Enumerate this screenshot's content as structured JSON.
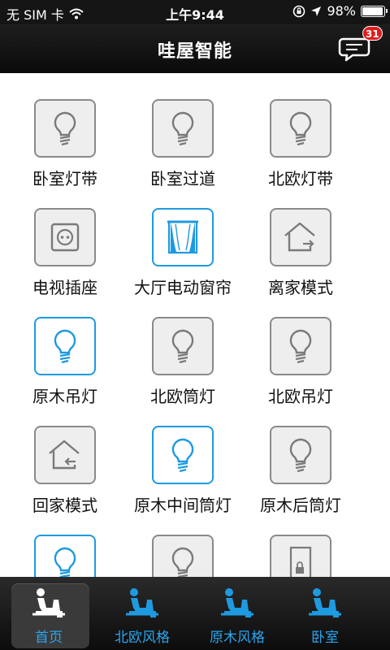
{
  "status_bar": {
    "carrier": "无 SIM 卡",
    "time": "上午9:44",
    "battery": "98%",
    "battery_level": 0.98
  },
  "header": {
    "title": "哇屋智能",
    "message_count": "31"
  },
  "devices": [
    {
      "label": "卧室灯带",
      "icon": "bulb-icon",
      "active": false
    },
    {
      "label": "卧室过道",
      "icon": "bulb-icon",
      "active": false
    },
    {
      "label": "北欧灯带",
      "icon": "bulb-icon",
      "active": false
    },
    {
      "label": "电视插座",
      "icon": "socket-icon",
      "active": false
    },
    {
      "label": "大厅电动窗帘",
      "icon": "curtain-icon",
      "active": true
    },
    {
      "label": "离家模式",
      "icon": "leave-home-icon",
      "active": false
    },
    {
      "label": "原木吊灯",
      "icon": "bulb-icon",
      "active": true
    },
    {
      "label": "北欧筒灯",
      "icon": "bulb-icon",
      "active": false
    },
    {
      "label": "北欧吊灯",
      "icon": "bulb-icon",
      "active": false
    },
    {
      "label": "回家模式",
      "icon": "return-home-icon",
      "active": false
    },
    {
      "label": "原木中间筒灯",
      "icon": "bulb-icon",
      "active": true
    },
    {
      "label": "原木后筒灯",
      "icon": "bulb-icon",
      "active": false
    },
    {
      "label": "",
      "icon": "bulb-icon",
      "active": true
    },
    {
      "label": "",
      "icon": "bulb-icon",
      "active": false
    },
    {
      "label": "",
      "icon": "door-lock-icon",
      "active": false
    }
  ],
  "tabs": [
    {
      "label": "首页",
      "active": true
    },
    {
      "label": "北欧风格",
      "active": false
    },
    {
      "label": "原木风格",
      "active": false
    },
    {
      "label": "卧室",
      "active": false
    }
  ],
  "colors": {
    "accent": "#1e9ae0",
    "inactive_border": "#8a8a8a",
    "tile_bg": "#eeeeee",
    "bar_dark": "#151515",
    "badge": "#e01b1b"
  }
}
